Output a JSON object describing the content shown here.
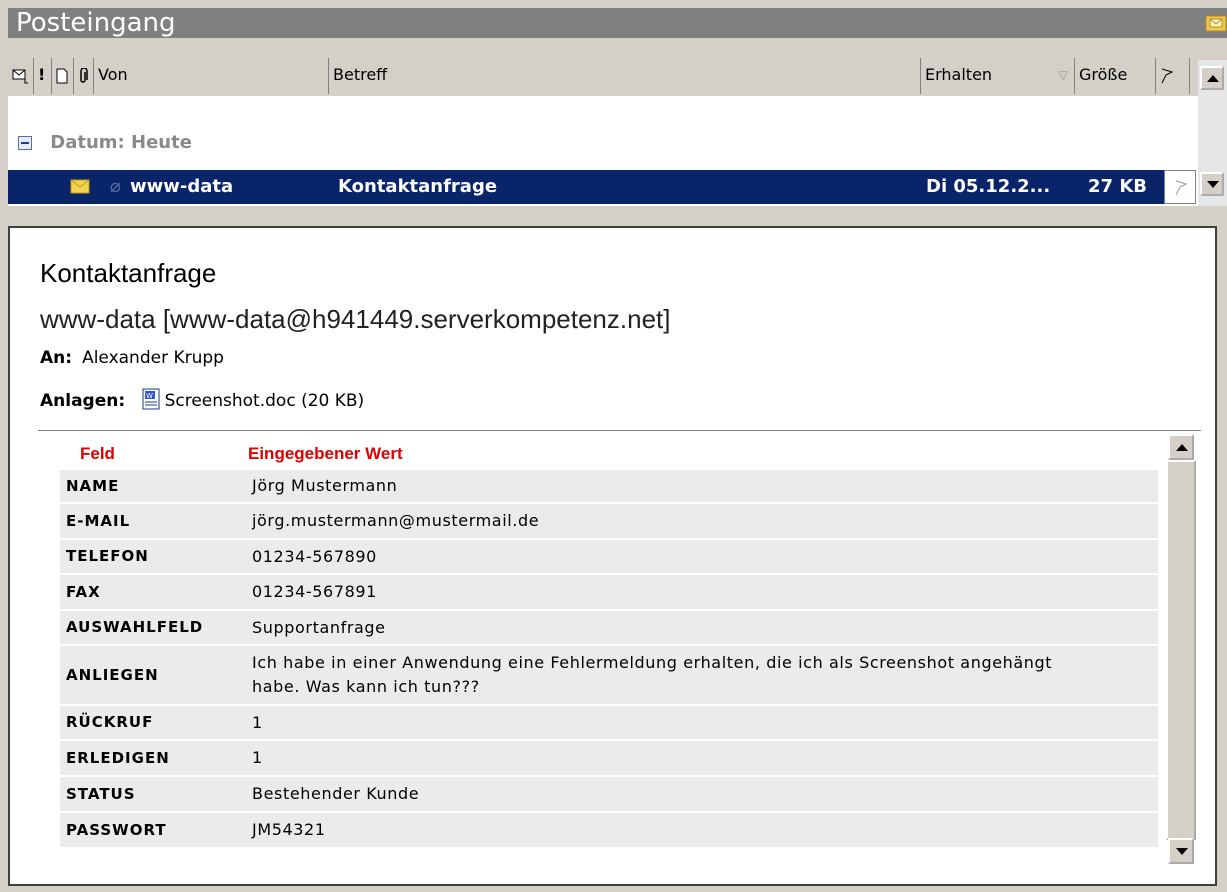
{
  "window": {
    "title": "Posteingang"
  },
  "columns": {
    "von": "Von",
    "betreff": "Betreff",
    "erhalten": "Erhalten",
    "groesse": "Größe"
  },
  "group": {
    "label": "Datum: Heute"
  },
  "message_row": {
    "from": "www-data",
    "subject": "Kontaktanfrage",
    "received": "Di 05.12.2...",
    "size": "27 KB"
  },
  "preview": {
    "subject": "Kontaktanfrage",
    "sender": "www-data [www-data@h941449.serverkompetenz.net]",
    "to_label": "An:",
    "to_value": "Alexander Krupp",
    "attach_label": "Anlagen:",
    "attach_value": "Screenshot.doc (20 KB)"
  },
  "form_table": {
    "header_field": "Feld",
    "header_value": "Eingegebener Wert",
    "rows": [
      {
        "key": "NAME",
        "value": "Jörg Mustermann"
      },
      {
        "key": "E-MAIL",
        "value": "jörg.mustermann@mustermail.de"
      },
      {
        "key": "TELEFON",
        "value": "01234-567890"
      },
      {
        "key": "FAX",
        "value": "01234-567891"
      },
      {
        "key": "AUSWAHLFELD",
        "value": "Supportanfrage"
      },
      {
        "key": "ANLIEGEN",
        "value": "Ich habe in einer Anwendung eine Fehlermeldung erhalten, die ich als Screenshot angehängt habe. Was kann ich tun???"
      },
      {
        "key": "RÜCKRUF",
        "value": "1"
      },
      {
        "key": "ERLEDIGEN",
        "value": "1"
      },
      {
        "key": "STATUS",
        "value": "Bestehender Kunde"
      },
      {
        "key": "PASSWORT",
        "value": "JM54321"
      }
    ]
  },
  "colors": {
    "selection": "#0a246a",
    "header_red": "#e00000",
    "title_bar": "#808080"
  }
}
